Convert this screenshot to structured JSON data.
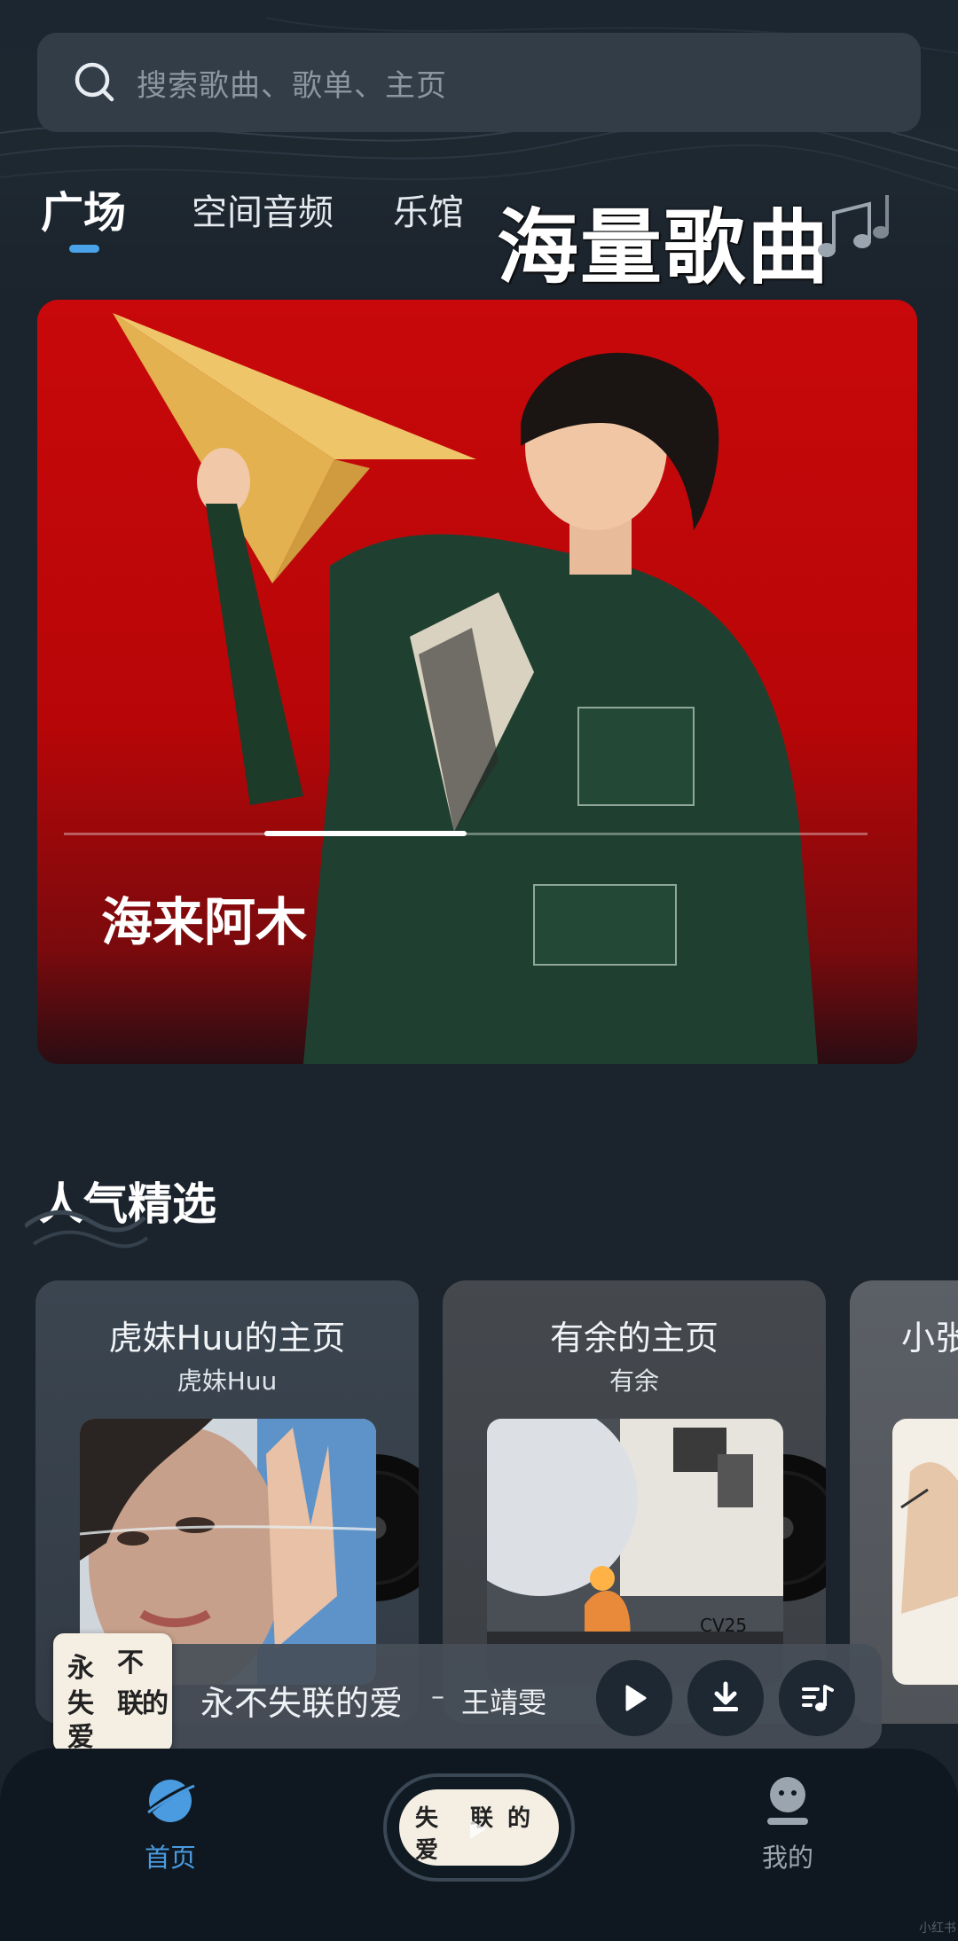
{
  "search": {
    "placeholder": "搜索歌曲、歌单、主页"
  },
  "tabs": [
    {
      "label": "广场",
      "active": true
    },
    {
      "label": "空间音频",
      "active": false
    },
    {
      "label": "乐馆",
      "active": false
    }
  ],
  "promo_text": "海量歌曲",
  "banner": {
    "title": "海来阿木",
    "progress_segment": 2,
    "progress_segments": 4
  },
  "section": {
    "title": "人气精选"
  },
  "cards": [
    {
      "title": "虎妹Huu的主页",
      "subtitle": "虎妹Huu"
    },
    {
      "title": "有余的主页",
      "subtitle": "有余"
    },
    {
      "title": "小张",
      "subtitle": ""
    }
  ],
  "now_playing": {
    "song": "永不失联的爱",
    "separator": "–",
    "artist": "王靖雯",
    "cover_text": [
      "永",
      "不",
      "失",
      "联",
      "的",
      "爱"
    ]
  },
  "nav": {
    "home_label": "首页",
    "mine_label": "我的",
    "home_color": "#4a9be0",
    "mine_color": "#9aa5b0"
  },
  "watermark": "小红书"
}
